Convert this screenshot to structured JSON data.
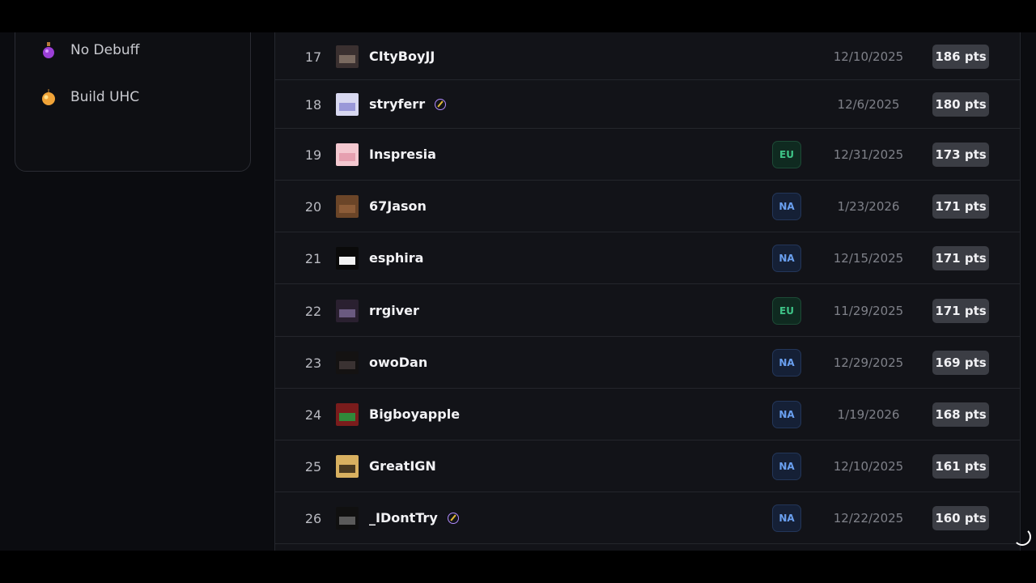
{
  "sidebar": {
    "items": [
      {
        "label": "No Debuff",
        "icon": "potion-icon"
      },
      {
        "label": "Build UHC",
        "icon": "golden-apple-icon"
      }
    ]
  },
  "leaderboard": {
    "rows": [
      {
        "rank": "17",
        "name": "CItyBoyJJ",
        "verified": false,
        "region": "",
        "date": "12/10/2025",
        "points": "186 pts",
        "avatar_colors": [
          "#3a3030",
          "#7a6a60"
        ]
      },
      {
        "rank": "18",
        "name": "stryferr",
        "verified": true,
        "region": "",
        "date": "12/6/2025",
        "points": "180 pts",
        "avatar_colors": [
          "#d8d8f0",
          "#9a98d8"
        ]
      },
      {
        "rank": "19",
        "name": "Inspresia",
        "verified": false,
        "region": "EU",
        "date": "12/31/2025",
        "points": "173 pts",
        "avatar_colors": [
          "#f4c8d0",
          "#e6a0b0"
        ]
      },
      {
        "rank": "20",
        "name": "67Jason",
        "verified": false,
        "region": "NA",
        "date": "1/23/2026",
        "points": "171 pts",
        "avatar_colors": [
          "#6b4528",
          "#8c5c38"
        ]
      },
      {
        "rank": "21",
        "name": "esphira",
        "verified": false,
        "region": "NA",
        "date": "12/15/2025",
        "points": "171 pts",
        "avatar_colors": [
          "#0a0a0a",
          "#f2f2f2"
        ]
      },
      {
        "rank": "22",
        "name": "rrgiver",
        "verified": false,
        "region": "EU",
        "date": "11/29/2025",
        "points": "171 pts",
        "avatar_colors": [
          "#2a2030",
          "#6a5a80"
        ]
      },
      {
        "rank": "23",
        "name": "owoDan",
        "verified": false,
        "region": "NA",
        "date": "12/29/2025",
        "points": "169 pts",
        "avatar_colors": [
          "#141212",
          "#3a3232"
        ]
      },
      {
        "rank": "24",
        "name": "Bigboyapple",
        "verified": false,
        "region": "NA",
        "date": "1/19/2026",
        "points": "168 pts",
        "avatar_colors": [
          "#7a1c1c",
          "#2f8a3a"
        ]
      },
      {
        "rank": "25",
        "name": "GreatIGN",
        "verified": false,
        "region": "NA",
        "date": "12/10/2025",
        "points": "161 pts",
        "avatar_colors": [
          "#d8b060",
          "#4a3a20"
        ]
      },
      {
        "rank": "26",
        "name": "_IDontTry",
        "verified": true,
        "region": "NA",
        "date": "12/22/2025",
        "points": "160 pts",
        "avatar_colors": [
          "#101010",
          "#5a5a5a"
        ]
      }
    ]
  }
}
